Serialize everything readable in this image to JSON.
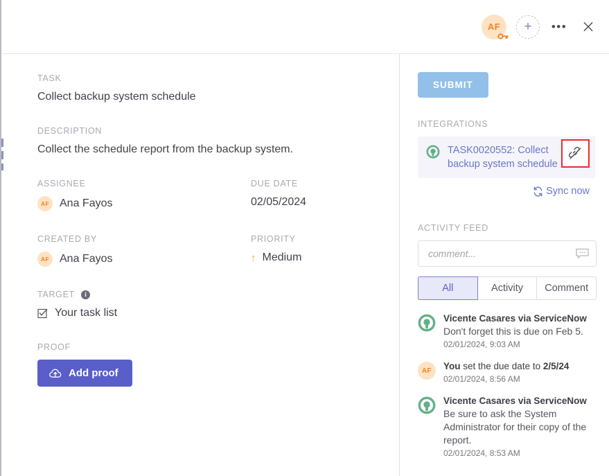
{
  "header": {
    "avatar_initials": "AF",
    "avatar_badge_icon": "key-icon",
    "add_label": "+",
    "more_label": "•••",
    "close_label": "×"
  },
  "left": {
    "task_label": "TASK",
    "task_value": "Collect backup system schedule",
    "description_label": "DESCRIPTION",
    "description_value": "Collect the schedule report from the backup system.",
    "assignee_label": "ASSIGNEE",
    "assignee_name": "Ana Fayos",
    "assignee_initials": "AF",
    "due_date_label": "DUE DATE",
    "due_date_value": "02/05/2024",
    "created_by_label": "CREATED BY",
    "created_by_name": "Ana Fayos",
    "created_by_initials": "AF",
    "priority_label": "PRIORITY",
    "priority_value": "Medium",
    "target_label": "TARGET",
    "target_value": "Your task list",
    "proof_label": "PROOF",
    "add_proof_label": "Add proof"
  },
  "right": {
    "submit_label": "SUBMIT",
    "integrations_label": "INTEGRATIONS",
    "integration_link": "TASK0020552: Collect backup system schedule",
    "unlink_title": "unlink-icon",
    "sync_label": "Sync now",
    "activity_feed_label": "ACTIVITY FEED",
    "comment_placeholder": "comment...",
    "comment_value": "",
    "tabs": [
      {
        "label": "All",
        "active": true
      },
      {
        "label": "Activity",
        "active": false
      },
      {
        "label": "Comment",
        "active": false
      }
    ],
    "feed": [
      {
        "author": "Vicente Casares via ServiceNow",
        "avatar_type": "servicenow",
        "initials": "",
        "text": "Don't forget this is due on Feb 5.",
        "time": "02/01/2024, 9:03 AM"
      },
      {
        "author": "You",
        "avatar_type": "user",
        "initials": "AF",
        "text_pre": " set the due date to ",
        "text_strong": "2/5/24",
        "time": "02/01/2024, 8:56 AM"
      },
      {
        "author": "Vicente Casares via ServiceNow",
        "avatar_type": "servicenow",
        "initials": "",
        "text": "Be sure to ask the System Administrator for their copy of the report.",
        "time": "02/01/2024, 8:53 AM"
      }
    ]
  },
  "colors": {
    "accent_purple": "#5a5ec8",
    "submit_blue": "#93c0e8",
    "avatar_orange": "#f58220",
    "servicenow_green": "#62b088",
    "highlight_red": "#ec2d2d",
    "label_grey": "#a9a9b4"
  }
}
